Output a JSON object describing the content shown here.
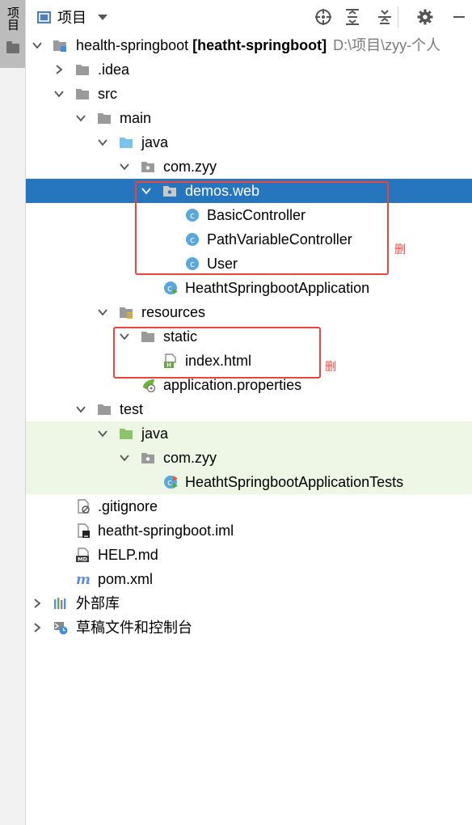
{
  "side_panel": {
    "tab_label": "项目"
  },
  "toolbar": {
    "view_label": "项目"
  },
  "tree": {
    "project": {
      "name": "health-springboot",
      "module": "[heatht-springboot]",
      "path": "D:\\项目\\zyy-个人"
    },
    "idea": ".idea",
    "src": "src",
    "main": "main",
    "java": "java",
    "com_zyy": "com.zyy",
    "demos_web": "demos.web",
    "basic_controller": "BasicController",
    "path_variable_controller": "PathVariableController",
    "user": "User",
    "app": "HeathtSpringbootApplication",
    "resources": "resources",
    "static": "static",
    "index_html": "index.html",
    "app_properties": "application.properties",
    "test": "test",
    "test_java": "java",
    "test_com_zyy": "com.zyy",
    "app_tests": "HeathtSpringbootApplicationTests",
    "gitignore": ".gitignore",
    "iml": "heatht-springboot.iml",
    "help_md": "HELP.md",
    "pom_xml": "pom.xml",
    "external_libs": "外部库",
    "scratches": "草稿文件和控制台"
  },
  "annotations": {
    "delete_label_1": "删",
    "delete_label_2": "删"
  },
  "colors": {
    "selection": "#2675bf",
    "test_background": "#eef6e5",
    "annotation_red": "#e8453c",
    "folder_gray": "#9a9a9a",
    "source_folder_blue": "#7cc3ec",
    "test_folder_green": "#8dc36b",
    "class_icon": "#59a8d9"
  }
}
